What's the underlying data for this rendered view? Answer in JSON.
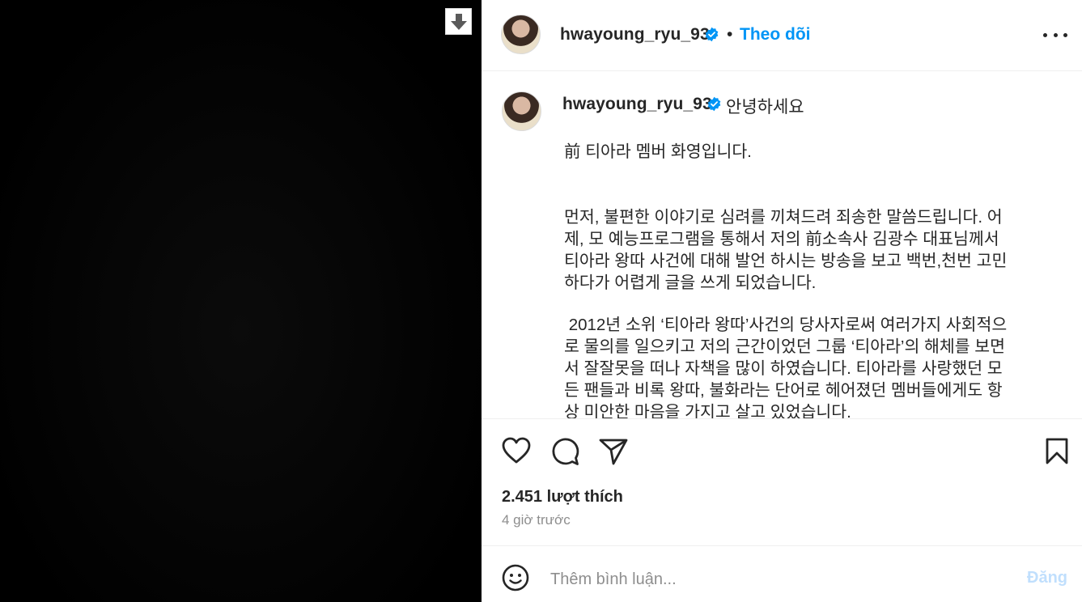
{
  "media": {
    "download_icon": "down-arrow-icon"
  },
  "header": {
    "username": "hwayoung_ryu_93",
    "verified_icon": "verified-badge-icon",
    "separator": "•",
    "follow_label": "Theo dõi",
    "more_icon": "more-horizontal-icon"
  },
  "caption": {
    "username": "hwayoung_ryu_93",
    "greeting": "안녕하세요",
    "lines": [
      "前 티아라 멤버 화영입니다.",
      "먼저, 불편한 이야기로 심려를 끼쳐드려 죄송한 말씀드립니다. 어",
      "제, 모 예능프로그램을 통해서 저의 前소속사 김광수 대표님께서",
      "티아라 왕따 사건에 대해 발언 하시는 방송을 보고 백번,천번 고민",
      "하다가 어렵게 글을 쓰게 되었습니다.",
      " 2012년 소위 ‘티아라 왕따’사건의 당사자로써 여러가지 사회적으",
      "로 물의를 일으키고 저의 근간이었던 그룹 ‘티아라’의 해체를 보면",
      "서 잘잘못을 떠나 자책을 많이 하였습니다. 티아라를 사랑했던 모",
      "든 팬들과 비록 왕따, 불화라는 단어로 헤어졌던 멤버들에게도 항",
      "상 미안한 마음을 가지고 살고 있었습니다."
    ]
  },
  "actions": {
    "like_icon": "heart-icon",
    "comment_icon": "comment-icon",
    "share_icon": "paper-plane-icon",
    "save_icon": "bookmark-icon"
  },
  "stats": {
    "likes": "2.451 lượt thích",
    "time": "4 giờ trước"
  },
  "comment_box": {
    "emoji_icon": "smiley-icon",
    "placeholder": "Thêm bình luận...",
    "post_label": "Đăng"
  },
  "colors": {
    "accent": "#0095f6",
    "post_disabled": "#c0dffd",
    "verified": "#0095f6"
  }
}
